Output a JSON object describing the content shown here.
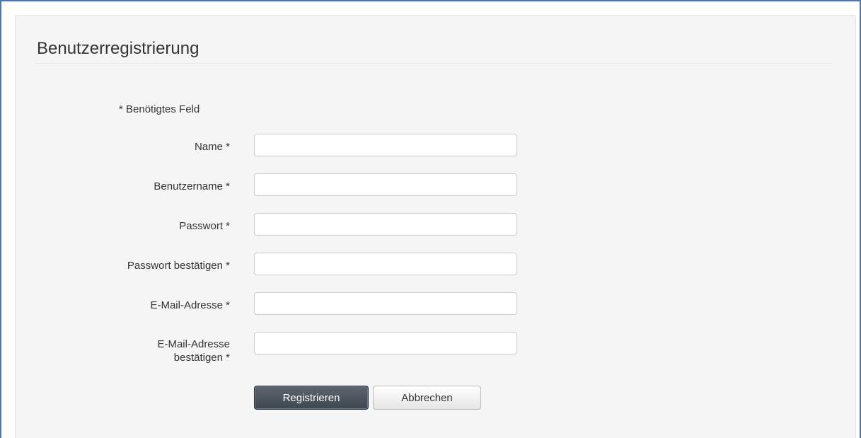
{
  "form": {
    "title": "Benutzerregistrierung",
    "required_note": "* Benötigtes Feld",
    "fields": [
      {
        "label": "Name *",
        "value": "",
        "placeholder": ""
      },
      {
        "label": "Benutzername *",
        "value": "",
        "placeholder": ""
      },
      {
        "label": "Passwort *",
        "value": "",
        "placeholder": ""
      },
      {
        "label": "Passwort bestätigen *",
        "value": "",
        "placeholder": ""
      },
      {
        "label": "E-Mail-Adresse *",
        "value": "",
        "placeholder": ""
      },
      {
        "label_line1": "E-Mail-Adresse",
        "label_line2": "bestätigen *",
        "value": "",
        "placeholder": ""
      }
    ],
    "buttons": {
      "register_label": "Registrieren",
      "cancel_label": "Abbrechen"
    }
  },
  "colors": {
    "frame_border": "#4a78b5",
    "panel_background": "#f5f5f5",
    "primary_button": "#4a535c",
    "text": "#333333"
  }
}
